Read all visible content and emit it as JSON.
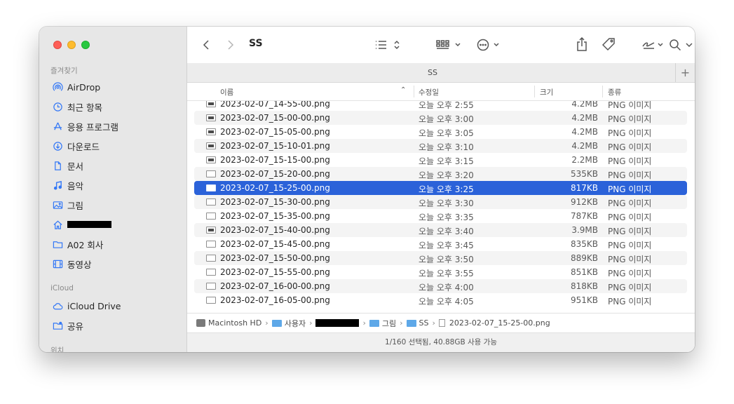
{
  "window": {
    "title": "SS"
  },
  "toolbar": {
    "title": "SS",
    "back_icon": "chevron-left",
    "forward_icon": "chevron-right",
    "list_view_icon": "list-bullet",
    "gallery_icon": "grid",
    "action_icon": "ellipsis-circle",
    "share_icon": "share",
    "tag_icon": "tag",
    "signature_icon": "signature",
    "more_icon": "chevron-down",
    "search_icon": "magnifyingglass"
  },
  "sidebar": {
    "favorites_label": "즐겨찾기",
    "icloud_label": "iCloud",
    "locations_label": "위치",
    "items": [
      {
        "label": "AirDrop",
        "icon": "airdrop"
      },
      {
        "label": "최근 항목",
        "icon": "clock"
      },
      {
        "label": "응용 프로그램",
        "icon": "apps"
      },
      {
        "label": "다운로드",
        "icon": "download"
      },
      {
        "label": "문서",
        "icon": "document"
      },
      {
        "label": "음악",
        "icon": "music"
      },
      {
        "label": "그림",
        "icon": "picture"
      },
      {
        "label": "",
        "icon": "home"
      },
      {
        "label": "A02 회사",
        "icon": "folder"
      },
      {
        "label": "동영상",
        "icon": "film"
      }
    ],
    "icloud_items": [
      {
        "label": "iCloud Drive",
        "icon": "cloud"
      },
      {
        "label": "공유",
        "icon": "shared-folder"
      }
    ]
  },
  "tabbar": {
    "label": "SS",
    "plus": "+"
  },
  "columns": {
    "name": "이름",
    "date": "수정일",
    "size": "크기",
    "kind": "종류"
  },
  "files": [
    {
      "name": "2023-02-07_14-55-00.png",
      "date": "오늘 오후 2:55",
      "size": "4.2MB",
      "kind": "PNG 이미지"
    },
    {
      "name": "2023-02-07_15-00-00.png",
      "date": "오늘 오후 3:00",
      "size": "4.2MB",
      "kind": "PNG 이미지"
    },
    {
      "name": "2023-02-07_15-05-00.png",
      "date": "오늘 오후 3:05",
      "size": "4.2MB",
      "kind": "PNG 이미지"
    },
    {
      "name": "2023-02-07_15-10-01.png",
      "date": "오늘 오후 3:10",
      "size": "4.2MB",
      "kind": "PNG 이미지"
    },
    {
      "name": "2023-02-07_15-15-00.png",
      "date": "오늘 오후 3:15",
      "size": "2.2MB",
      "kind": "PNG 이미지"
    },
    {
      "name": "2023-02-07_15-20-00.png",
      "date": "오늘 오후 3:20",
      "size": "535KB",
      "kind": "PNG 이미지"
    },
    {
      "name": "2023-02-07_15-25-00.png",
      "date": "오늘 오후 3:25",
      "size": "817KB",
      "kind": "PNG 이미지"
    },
    {
      "name": "2023-02-07_15-30-00.png",
      "date": "오늘 오후 3:30",
      "size": "912KB",
      "kind": "PNG 이미지"
    },
    {
      "name": "2023-02-07_15-35-00.png",
      "date": "오늘 오후 3:35",
      "size": "787KB",
      "kind": "PNG 이미지"
    },
    {
      "name": "2023-02-07_15-40-00.png",
      "date": "오늘 오후 3:40",
      "size": "3.9MB",
      "kind": "PNG 이미지"
    },
    {
      "name": "2023-02-07_15-45-00.png",
      "date": "오늘 오후 3:45",
      "size": "835KB",
      "kind": "PNG 이미지"
    },
    {
      "name": "2023-02-07_15-50-00.png",
      "date": "오늘 오후 3:50",
      "size": "889KB",
      "kind": "PNG 이미지"
    },
    {
      "name": "2023-02-07_15-55-00.png",
      "date": "오늘 오후 3:55",
      "size": "851KB",
      "kind": "PNG 이미지"
    },
    {
      "name": "2023-02-07_16-00-00.png",
      "date": "오늘 오후 4:00",
      "size": "818KB",
      "kind": "PNG 이미지"
    },
    {
      "name": "2023-02-07_16-05-00.png",
      "date": "오늘 오후 4:05",
      "size": "951KB",
      "kind": "PNG 이미지"
    }
  ],
  "pathbar": {
    "items": [
      "Macintosh HD",
      "사용자",
      "",
      "그림",
      "SS",
      "2023-02-07_15-25-00.png"
    ],
    "separator": "›"
  },
  "status": {
    "text": "1/160 선택됨, 40.88GB 사용 가능"
  },
  "colors": {
    "selection": "#2b62d9",
    "accent": "#3478f6"
  }
}
